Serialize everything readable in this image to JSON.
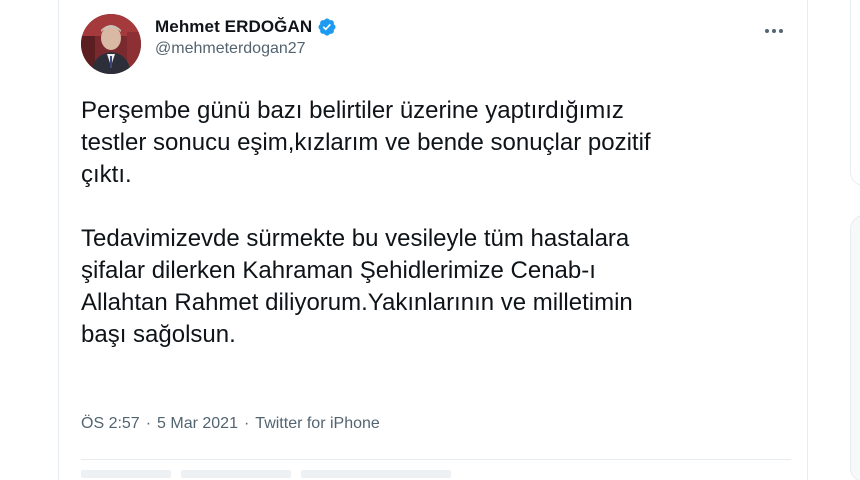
{
  "tweet": {
    "author": {
      "display_name": "Mehmet ERDOĞAN",
      "handle": "@mehmeterdogan27",
      "verified": true,
      "avatar_icon": "profile-photo"
    },
    "text": "Perşembe günü bazı belirtiler üzerine yaptırdığımız\ntestler sonucu eşim,kızlarım ve bende sonuçlar pozitif\nçıktı.\n\nTedavimizevde sürmekte bu vesileyle tüm hastalara\nşifalar dilerken Kahraman Şehidlerimize Cenab-ı\nAllahtan Rahmet diliyorum.Yakınlarının ve milletimin\nbaşı sağolsun.",
    "time": "ÖS 2:57",
    "separator": "·",
    "date": "5 Mar 2021",
    "source": "Twitter for iPhone",
    "more_icon": "more-horizontal-icon"
  },
  "colors": {
    "text_primary": "#0f1419",
    "text_secondary": "#536471",
    "verified_blue": "#1d9bf0",
    "divider": "#e6ecf0"
  }
}
